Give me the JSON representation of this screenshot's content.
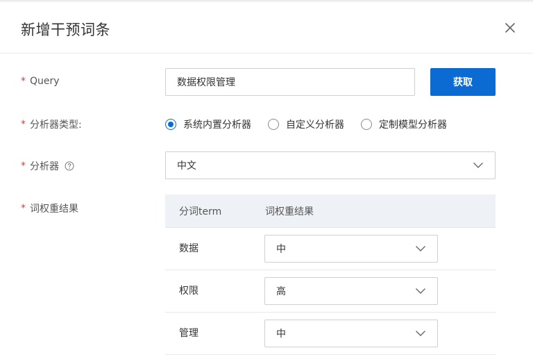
{
  "dialog": {
    "title": "新增干预词条"
  },
  "form": {
    "query": {
      "label": "Query",
      "required_mark": "*",
      "value": "数据权限管理",
      "button_label": "获取"
    },
    "analyzer_type": {
      "label": "分析器类型:",
      "required_mark": "*",
      "options": [
        {
          "label": "系统内置分析器",
          "checked": true
        },
        {
          "label": "自定义分析器",
          "checked": false
        },
        {
          "label": "定制模型分析器",
          "checked": false
        }
      ]
    },
    "analyzer": {
      "label": "分析器",
      "required_mark": "*",
      "help_icon": "question-circle-icon",
      "value": "中文"
    },
    "weights": {
      "label": "词权重结果",
      "required_mark": "*",
      "columns": [
        "分词term",
        "词权重结果"
      ],
      "rows": [
        {
          "term": "数据",
          "weight": "中"
        },
        {
          "term": "权限",
          "weight": "高"
        },
        {
          "term": "管理",
          "weight": "中"
        }
      ]
    }
  },
  "colors": {
    "primary": "#0b6bd3",
    "required": "#e43a3a",
    "table_header_bg": "#eef1f6"
  }
}
